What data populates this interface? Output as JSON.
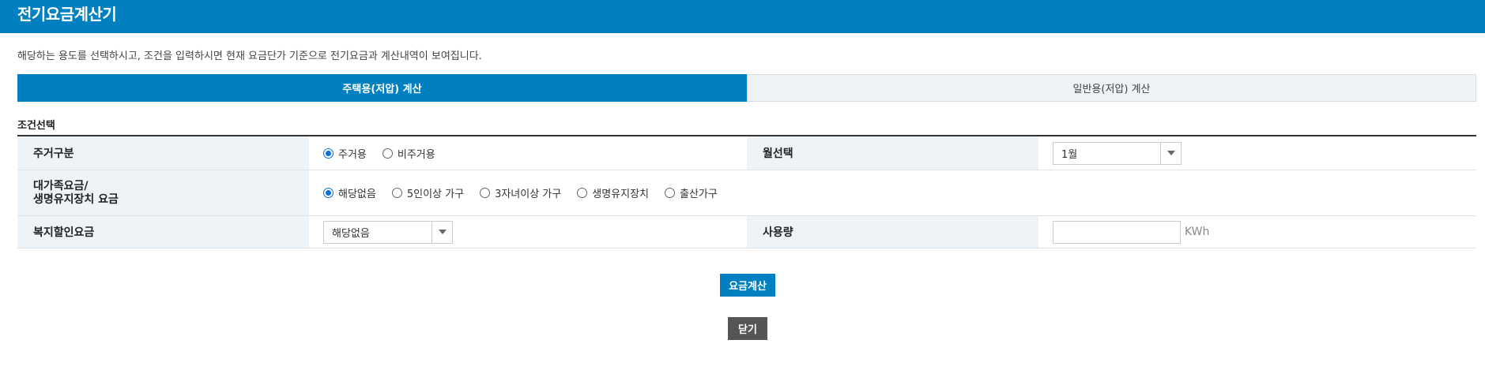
{
  "header": {
    "title": "전기요금계산기"
  },
  "description": "해당하는 용도를 선택하시고, 조건을 입력하시면 현재 요금단가 기준으로 전기요금과 계산내역이 보여집니다.",
  "tabs": [
    {
      "label": "주택용(저압) 계산",
      "active": true
    },
    {
      "label": "일반용(저압) 계산",
      "active": false
    }
  ],
  "section_title": "조건선택",
  "form": {
    "residence": {
      "label": "주거구분",
      "options": [
        {
          "label": "주거용",
          "checked": true
        },
        {
          "label": "비주거용",
          "checked": false
        }
      ]
    },
    "month": {
      "label": "월선택",
      "selected": "1월"
    },
    "family_rate": {
      "label_line1": "대가족요금/",
      "label_line2": "생명유지장치 요금",
      "options": [
        {
          "label": "해당없음",
          "checked": true
        },
        {
          "label": "5인이상 가구",
          "checked": false
        },
        {
          "label": "3자녀이상 가구",
          "checked": false
        },
        {
          "label": "생명유지장치",
          "checked": false
        },
        {
          "label": "출산가구",
          "checked": false
        }
      ]
    },
    "welfare": {
      "label": "복지할인요금",
      "selected": "해당없음"
    },
    "usage": {
      "label": "사용량",
      "value": "",
      "placeholder": "",
      "unit": "KWh"
    }
  },
  "buttons": {
    "calculate": "요금계산",
    "close": "닫기"
  },
  "colors": {
    "primary": "#0080c0",
    "close_button": "#555555",
    "header_cell_bg": "#eef3f7"
  }
}
